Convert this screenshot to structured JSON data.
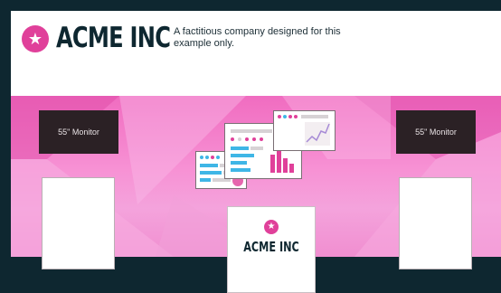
{
  "brand": {
    "name": "ACME INC",
    "tagline": "A factitious company designed for this example only.",
    "accent_color": "#e0409a",
    "badge_icon": "star-icon"
  },
  "monitors": {
    "left_label": "55\" Monitor",
    "right_label": "55\" Monitor"
  },
  "counter": {
    "brand_name": "ACME INC"
  },
  "colors": {
    "background": "#0e2730",
    "wall_pink": "#f06cc0",
    "chart_blue": "#3fb6e6",
    "chart_pink": "#e0409a"
  }
}
